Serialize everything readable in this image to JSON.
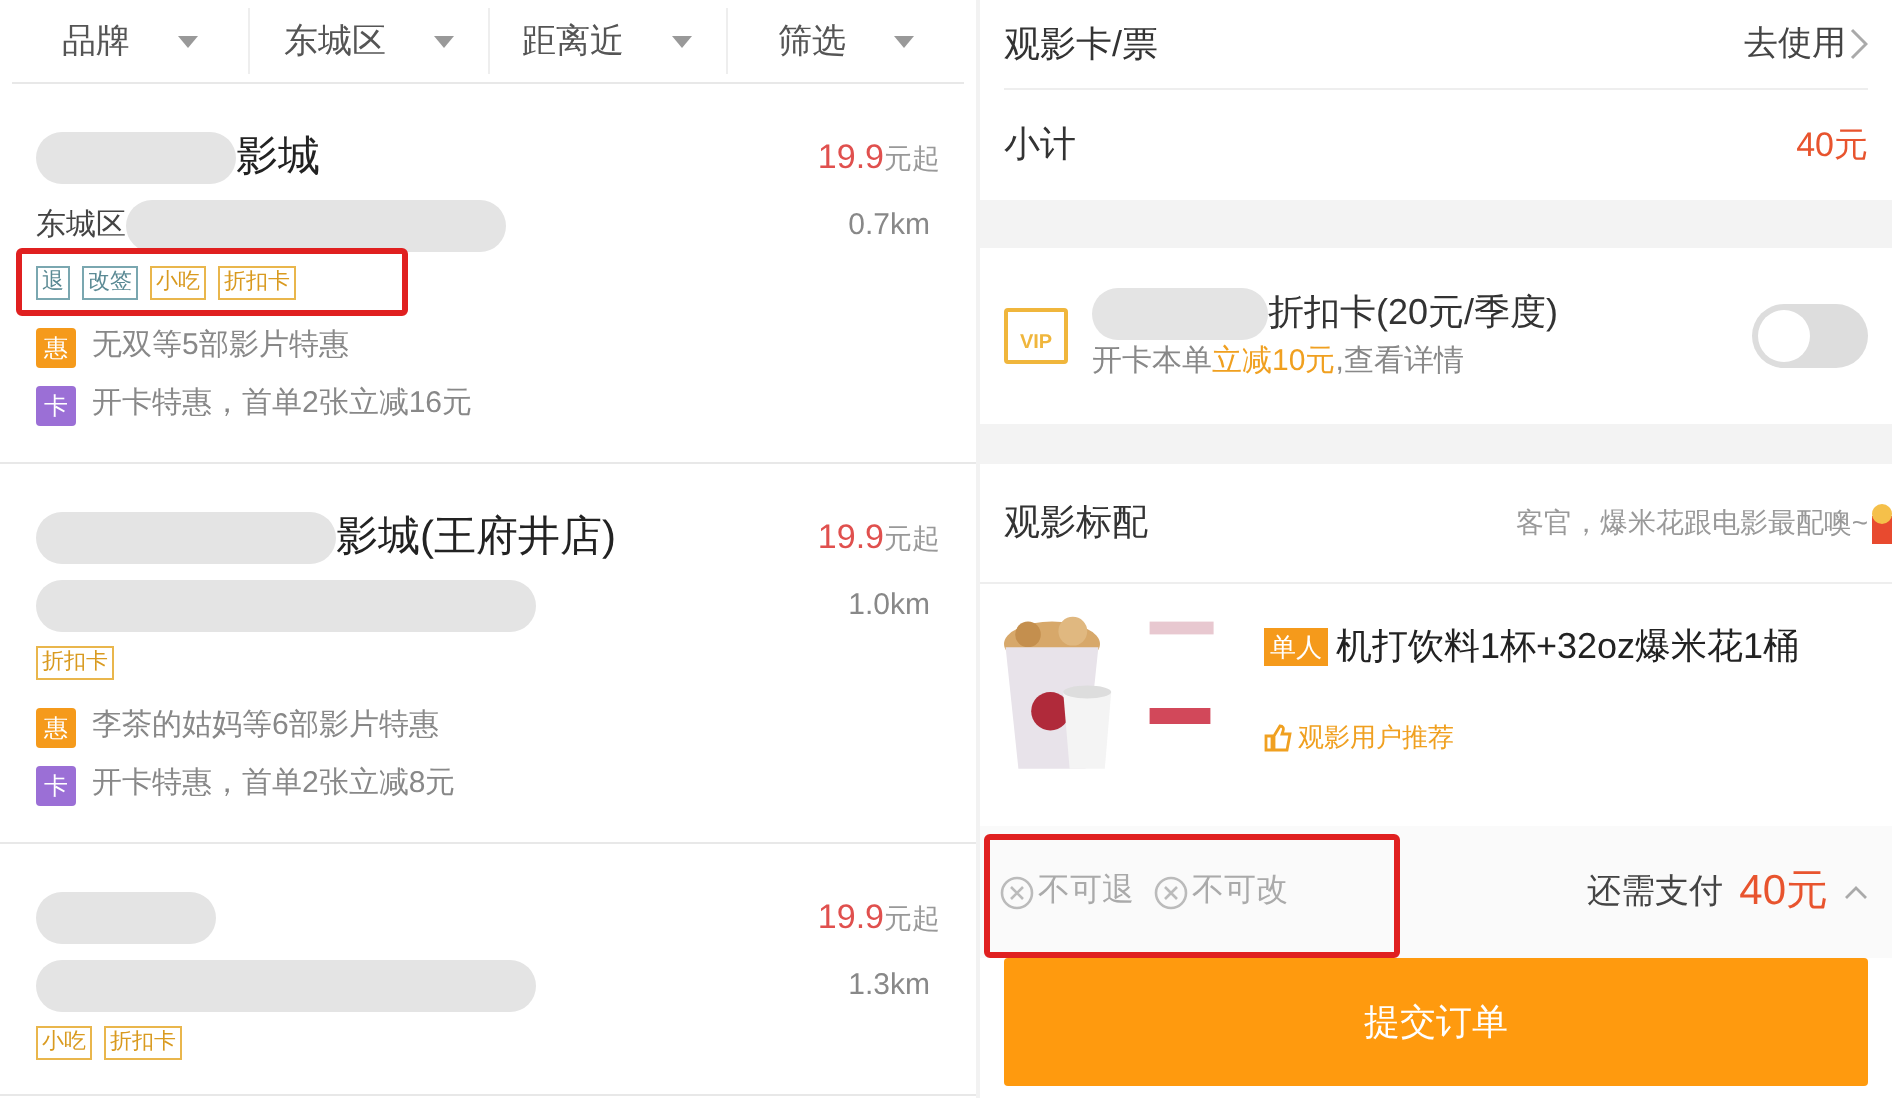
{
  "filters": [
    {
      "label": "品牌"
    },
    {
      "label": "东城区"
    },
    {
      "label": "距离近"
    },
    {
      "label": "筛选"
    }
  ],
  "cinemas": [
    {
      "name": "影城",
      "price": "19.9",
      "unit": "元起",
      "district": "东城区",
      "distance": "0.7km",
      "tags_highlighted": true,
      "tags": [
        {
          "label": "退",
          "kind": "service"
        },
        {
          "label": "改签",
          "kind": "service"
        },
        {
          "label": "小吃",
          "kind": "perk"
        },
        {
          "label": "折扣卡",
          "kind": "perk"
        }
      ],
      "offers": [
        {
          "kind": "discount",
          "badge": "惠",
          "text": "无双等5部影片特惠"
        },
        {
          "kind": "card",
          "badge": "卡",
          "text": "开卡特惠，首单2张立减16元"
        }
      ]
    },
    {
      "name": "影城(王府井店)",
      "price": "19.9",
      "unit": "元起",
      "distance": "1.0km",
      "tags": [
        {
          "label": "折扣卡",
          "kind": "perk"
        }
      ],
      "offers": [
        {
          "kind": "discount",
          "badge": "惠",
          "text": "李茶的姑妈等6部影片特惠"
        },
        {
          "kind": "card",
          "badge": "卡",
          "text": "开卡特惠，首单2张立减8元"
        }
      ]
    },
    {
      "price": "19.9",
      "unit": "元起",
      "distance": "1.3km",
      "tags": [
        {
          "label": "小吃",
          "kind": "perk"
        },
        {
          "label": "折扣卡",
          "kind": "perk"
        }
      ]
    }
  ],
  "order": {
    "ticket_card": {
      "label": "观影卡/票",
      "action": "去使用"
    },
    "subtotal": {
      "label": "小计",
      "amount": "40元"
    },
    "vip": {
      "badge": "VIP",
      "title": "折扣卡(20元/季度)",
      "note_prefix": "开卡本单",
      "note_highlight": "立减10元",
      "note_suffix": ",查看详情",
      "on": false
    },
    "combo": {
      "title": "观影标配",
      "hint": "客官，爆米花跟电影最配噢~",
      "product": {
        "badge": "单人",
        "name": "机打饮料1杯+32oz爆米花1桶",
        "recommend": "观影用户推荐"
      }
    },
    "footer": {
      "policies_highlighted": true,
      "policies": [
        {
          "label": "不可退"
        },
        {
          "label": "不可改"
        }
      ],
      "pay_label": "还需支付",
      "pay_amount": "40元"
    },
    "submit": "提交订单"
  }
}
